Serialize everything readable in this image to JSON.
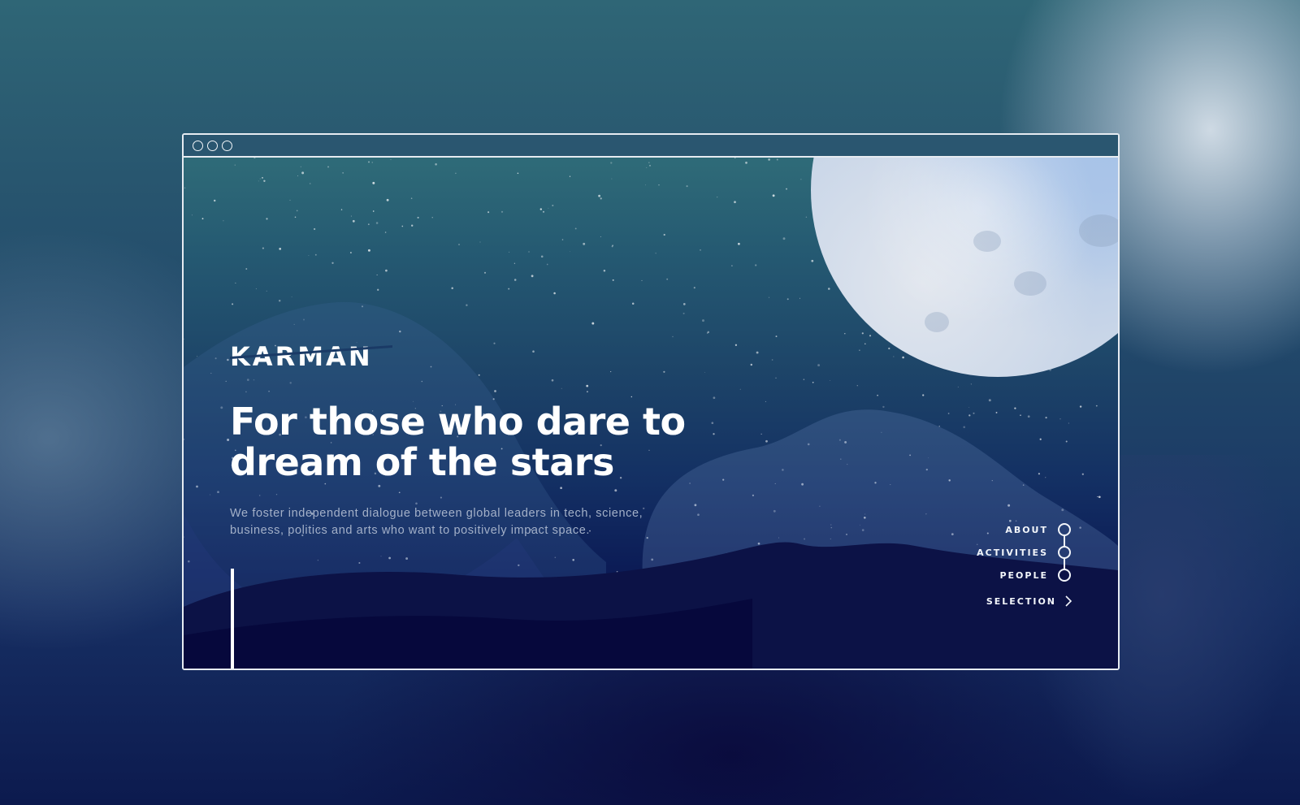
{
  "window": {
    "controls": [
      "window-dot-1",
      "window-dot-2",
      "window-dot-3"
    ]
  },
  "hero": {
    "logo_text": "KARMAN",
    "headline_line1": "For those who dare to",
    "headline_line2": "dream of the stars",
    "subtext_line1": "We foster independent dialogue between global leaders in tech, science,",
    "subtext_line2": "business, politics and arts who want to positively impact space."
  },
  "nav": {
    "items": [
      {
        "label": "ABOUT"
      },
      {
        "label": "ACTIVITIES"
      },
      {
        "label": "PEOPLE"
      }
    ],
    "selection_label": "SELECTION",
    "selection_icon": "chevron-right-icon"
  },
  "colors": {
    "frame": "#e6ebf1",
    "text": "#ffffff",
    "subtext": "#a3b0c8",
    "sky_top": "#2f6b78",
    "sky_bottom": "#07103f"
  }
}
